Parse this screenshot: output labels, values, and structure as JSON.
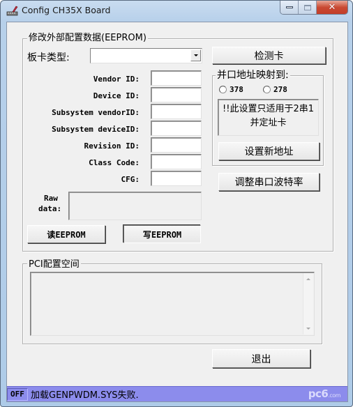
{
  "window": {
    "title": "Config CH35X Board",
    "icon": "app-board-icon",
    "controls": {
      "minimize": "minimize-icon",
      "maximize": "maximize-icon",
      "close": "close-icon"
    }
  },
  "eeprom_group": {
    "label": "修改外部配置数据(EEPROM)",
    "board_type_label": "板卡类型:",
    "board_type_value": "",
    "fields": [
      {
        "label": "Vendor ID:",
        "value": ""
      },
      {
        "label": "Device ID:",
        "value": ""
      },
      {
        "label": "Subsystem vendorID:",
        "value": ""
      },
      {
        "label": "Subsystem deviceID:",
        "value": ""
      },
      {
        "label": "Revision ID:",
        "value": ""
      },
      {
        "label": "Class Code:",
        "value": ""
      },
      {
        "label": "CFG:",
        "value": ""
      }
    ],
    "raw_data_label_line1": "Raw",
    "raw_data_label_line2": "data:",
    "raw_data_value": "",
    "read_button": "读EEPROM",
    "write_button": "写EEPROM"
  },
  "right_panel": {
    "detect_button": "检测卡",
    "parallel_group": {
      "label": "并口地址映射到:",
      "options": [
        {
          "label": "378",
          "selected": false
        },
        {
          "label": "278",
          "selected": false
        }
      ],
      "note": "!!此设置只适用于2串1并定址卡",
      "set_address_button": "设置新地址"
    },
    "baud_button": "调整串口波特率"
  },
  "pci_group": {
    "label": "PCI配置空间",
    "content": ""
  },
  "exit_button": "退出",
  "statusbar": {
    "state": "OFF",
    "message": "加载GENPWDM.SYS失败.",
    "watermark": "pc6",
    "watermark_suffix": ".com"
  }
}
